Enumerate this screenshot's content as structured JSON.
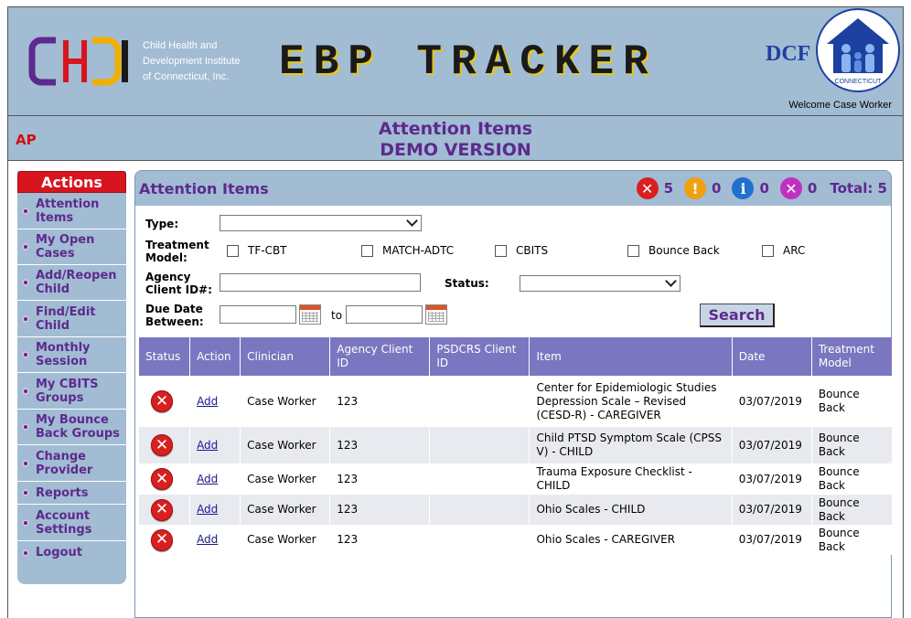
{
  "header": {
    "org_lines": [
      "Child Health and",
      "Development Institute",
      "of Connecticut, Inc."
    ],
    "app_title": "EBP TRACKER",
    "dcf_text": "DCF",
    "dcf_state": "CONNECTICUT",
    "welcome": "Welcome Case Worker"
  },
  "titlebar": {
    "user_initials": "AP",
    "title": "Attention Items",
    "subtitle": "DEMO VERSION"
  },
  "sidebar": {
    "heading": "Actions",
    "items": [
      {
        "label": "Attention Items"
      },
      {
        "label": "My Open Cases"
      },
      {
        "label": "Add/Reopen Child"
      },
      {
        "label": "Find/Edit Child"
      },
      {
        "label": "Monthly Session"
      },
      {
        "label": "My CBITS Groups"
      },
      {
        "label": "My Bounce Back Groups"
      },
      {
        "label": "Change Provider"
      },
      {
        "label": "Reports"
      },
      {
        "label": "Account Settings"
      },
      {
        "label": "Logout"
      }
    ]
  },
  "panel": {
    "title": "Attention Items",
    "counts": {
      "error": "5",
      "warning": "0",
      "info": "0",
      "other": "0",
      "total": "Total: 5"
    },
    "colors": {
      "error": "#d82020",
      "warning": "#f0a010",
      "info": "#2070d0",
      "other": "#c030c0"
    }
  },
  "filters": {
    "type_label": "Type:",
    "type_value": "",
    "treatment_label_1": "Treatment",
    "treatment_label_2": "Model:",
    "models": [
      "TF-CBT",
      "MATCH-ADTC",
      "CBITS",
      "Bounce Back",
      "ARC"
    ],
    "agency_label_1": "Agency",
    "agency_label_2": "Client ID#:",
    "agency_value": "",
    "status_label": "Status:",
    "status_value": "",
    "due_label_1": "Due Date",
    "due_label_2": "Between:",
    "date_from": "",
    "to_label": "to",
    "date_to": "",
    "search_button": "Search"
  },
  "table": {
    "columns": [
      "Status",
      "Action",
      "Clinician",
      "Agency Client ID",
      "PSDCRS Client ID",
      "Item",
      "Date",
      "Treatment Model"
    ],
    "rows": [
      {
        "action": "Add",
        "clinician": "Case Worker",
        "agency_id": "123",
        "psdcrs_id": "",
        "item": "Center for Epidemiologic Studies Depression Scale – Revised (CESD-R) - CAREGIVER",
        "date": "03/07/2019",
        "model": "Bounce Back"
      },
      {
        "action": "Add",
        "clinician": "Case Worker",
        "agency_id": "123",
        "psdcrs_id": "",
        "item": "Child PTSD Symptom Scale (CPSS V) - CHILD",
        "date": "03/07/2019",
        "model": "Bounce Back"
      },
      {
        "action": "Add",
        "clinician": "Case Worker",
        "agency_id": "123",
        "psdcrs_id": "",
        "item": "Trauma Exposure Checklist - CHILD",
        "date": "03/07/2019",
        "model": "Bounce Back"
      },
      {
        "action": "Add",
        "clinician": "Case Worker",
        "agency_id": "123",
        "psdcrs_id": "",
        "item": "Ohio Scales - CHILD",
        "date": "03/07/2019",
        "model": "Bounce Back"
      },
      {
        "action": "Add",
        "clinician": "Case Worker",
        "agency_id": "123",
        "psdcrs_id": "",
        "item": "Ohio Scales - CAREGIVER",
        "date": "03/07/2019",
        "model": "Bounce Back"
      }
    ]
  }
}
